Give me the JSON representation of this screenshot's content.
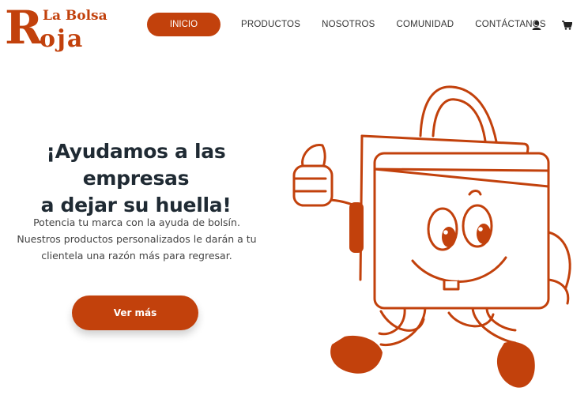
{
  "brand": {
    "top_line": "La Bolsa",
    "big_letter": "R",
    "bottom_line": "oja",
    "color": "#c2410c"
  },
  "nav": {
    "items": [
      {
        "label": "INICIO",
        "active": true
      },
      {
        "label": "PRODUCTOS"
      },
      {
        "label": "NOSOTROS"
      },
      {
        "label": "COMUNIDAD"
      },
      {
        "label": "CONTÁCTANOS"
      }
    ],
    "icons": [
      "user-icon",
      "cart-icon"
    ]
  },
  "hero": {
    "title_line1": "¡Ayudamos a las empresas",
    "title_line2": "a dejar su huella!",
    "text": "Potencia tu marca con la ayuda de bolsín. Nuestros productos personalizados le darán a tu clientela una razón más para regresar.",
    "cta_label": "Ver más",
    "illustration": "bag-mascot-illustration"
  },
  "colors": {
    "accent": "#c2410c",
    "text": "#1f2a33"
  }
}
